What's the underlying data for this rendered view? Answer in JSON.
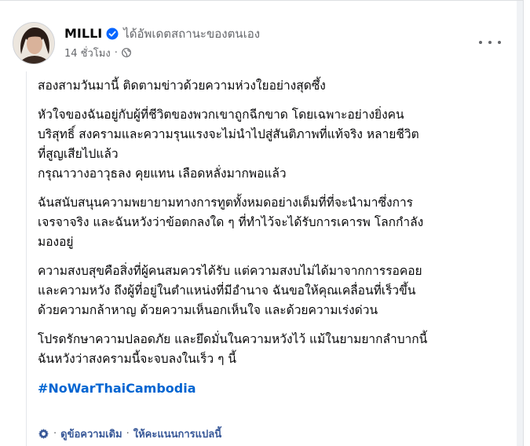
{
  "post": {
    "author": "MILLI",
    "status": "ได้อัพเดตสถานะของตนเอง",
    "time": "14 ชั่วโมง",
    "separator": "·",
    "paragraphs": [
      [
        "สองสามวันมานี้ ติดตามข่าวด้วยความห่วงใยอย่างสุดซึ้ง"
      ],
      [
        "หัวใจของฉันอยู่กับผู้ที่ชีวิตของพวกเขาถูกฉีกขาด โดยเฉพาะอย่างยิ่งคน",
        "บริสุทธิ์ สงครามและความรุนแรงจะไม่นำไปสู่สันติภาพที่แท้จริง หลายชีวิต",
        "ที่สูญเสียไปแล้ว",
        "กรุณาวางอาวุธลง คุยแทน เลือดหลั่งมากพอแล้ว"
      ],
      [
        "ฉันสนับสนุนความพยายามทางการทูตทั้งหมดอย่างเต็มที่ที่จะนำมาซึ่งการ",
        "เจรจาจริง และฉันหวังว่าข้อตกลงใด ๆ ที่ทำไว้จะได้รับการเคารพ โลกกำลัง",
        "มองอยู่"
      ],
      [
        "ความสงบสุขคือสิ่งที่ผู้คนสมควรได้รับ แต่ความสงบไม่ได้มาจากการรอคอย",
        "และความหวัง ถึงผู้ที่อยู่ในตำแหน่งที่มีอำนาจ ฉันขอให้คุณเคลื่อนที่เร็วขึ้น",
        "ด้วยความกล้าหาญ ด้วยความเห็นอกเห็นใจ และด้วยความเร่งด่วน"
      ],
      [
        "โปรดรักษาความปลอดภัย และยึดมั่นในความหวังไว้ แม้ในยามยากลำบากนี้",
        "ฉันหวังว่าสงครามนี้จะจบลงในเร็ว ๆ นี้"
      ]
    ],
    "hashtag": "#NoWarThaiCambodia"
  },
  "footer": {
    "see_original": "ดูข้อความเดิม",
    "separator": "·",
    "rate_translation": "ให้คะแนนการแปลนี้"
  },
  "colors": {
    "link": "#0064d1",
    "footer_link": "#385898",
    "secondary_text": "#65676b",
    "verified_badge": "#0866ff"
  }
}
